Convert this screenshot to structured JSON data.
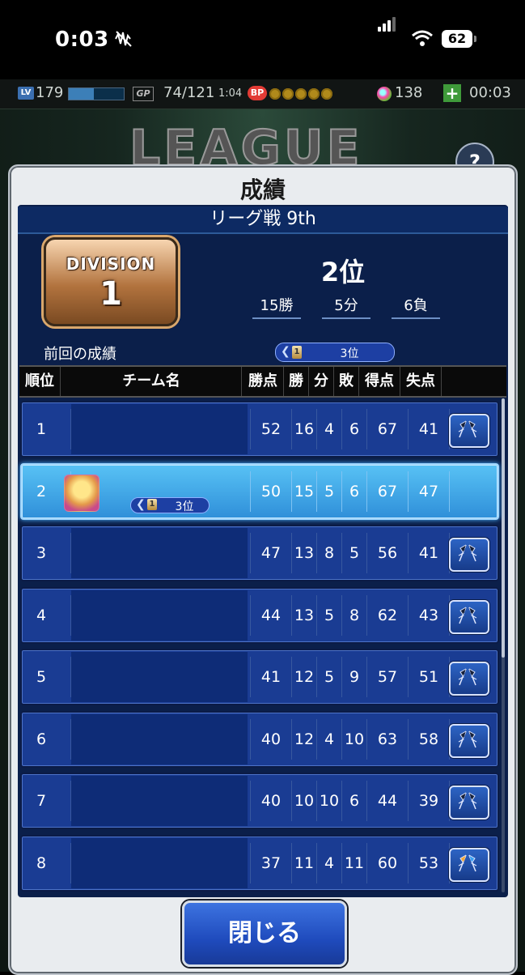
{
  "status_bar": {
    "time": "0:03",
    "battery": "62"
  },
  "game_header": {
    "level_label": "LV",
    "level": "179",
    "gp_label": "GP",
    "gp": "74/121",
    "gp_timer": "1:04",
    "bp_label": "BP",
    "orb_count": "138",
    "timer": "00:03"
  },
  "background": {
    "banner": "LEAGUE",
    "help_label": "?"
  },
  "dialog": {
    "title": "成績",
    "league_round": "リーグ戦 9th",
    "division": {
      "label": "DIVISION",
      "number": "1"
    },
    "rank": "2位",
    "record": {
      "wins": "15勝",
      "draws": "5分",
      "losses": "6負"
    },
    "previous": {
      "label": "前回の成績",
      "division_icon": "1",
      "rank": "3位"
    },
    "table": {
      "headers": [
        "順位",
        "チーム名",
        "勝点",
        "勝",
        "分",
        "敗",
        "得点",
        "失点"
      ],
      "rows": [
        {
          "rank": "1",
          "points": "52",
          "w": "16",
          "d": "4",
          "l": "6",
          "gf": "67",
          "ga": "41",
          "flag": "dark"
        },
        {
          "rank": "2",
          "points": "50",
          "w": "15",
          "d": "5",
          "l": "6",
          "gf": "67",
          "ga": "47",
          "flag": "none",
          "prev_rank": "3位",
          "prev_div": "1",
          "me": true
        },
        {
          "rank": "3",
          "points": "47",
          "w": "13",
          "d": "8",
          "l": "5",
          "gf": "56",
          "ga": "41",
          "flag": "dark"
        },
        {
          "rank": "4",
          "points": "44",
          "w": "13",
          "d": "5",
          "l": "8",
          "gf": "62",
          "ga": "43",
          "flag": "dark"
        },
        {
          "rank": "5",
          "points": "41",
          "w": "12",
          "d": "5",
          "l": "9",
          "gf": "57",
          "ga": "51",
          "flag": "dark"
        },
        {
          "rank": "6",
          "points": "40",
          "w": "12",
          "d": "4",
          "l": "10",
          "gf": "63",
          "ga": "58",
          "flag": "dark"
        },
        {
          "rank": "7",
          "points": "40",
          "w": "10",
          "d": "10",
          "l": "6",
          "gf": "44",
          "ga": "39",
          "flag": "dark"
        },
        {
          "rank": "8",
          "points": "37",
          "w": "11",
          "d": "4",
          "l": "11",
          "gf": "60",
          "ga": "53",
          "flag": "color"
        }
      ]
    },
    "close_label": "閉じる"
  },
  "colors": {
    "panel": "#0b1f4a",
    "row": "#1a3c93",
    "row_highlight": "#3aa6ee",
    "button": "#1f4bbd"
  }
}
